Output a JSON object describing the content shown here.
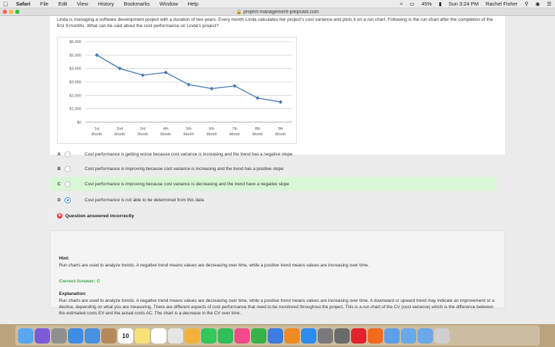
{
  "menubar": {
    "app": "Safari",
    "items": [
      "File",
      "Edit",
      "View",
      "History",
      "Bookmarks",
      "Window",
      "Help"
    ],
    "battery": "45%",
    "clock": "Sun 3:24 PM",
    "user": "Rachel Fisher"
  },
  "browser": {
    "url": "project-management-prepcast.com"
  },
  "question": {
    "text": "Linda is managing a software development project with a duration of two years. Every month Linda calculates her project's cost variance and plots it on a run chart. Following is the run chart after the completion of the first 9 months. What can be said about the cost performance on Linda's project?"
  },
  "chart_data": {
    "type": "line",
    "categories": [
      "1st Month",
      "2nd Month",
      "3rd Month",
      "4th Month",
      "5th Month",
      "6th Month",
      "7th Month",
      "8th Month",
      "9th Month"
    ],
    "category_lines": [
      [
        "1st",
        "Month"
      ],
      [
        "2nd",
        "Month"
      ],
      [
        "3rd",
        "Month"
      ],
      [
        "4th",
        "Month"
      ],
      [
        "5th",
        "Month"
      ],
      [
        "6th",
        "Month"
      ],
      [
        "7th",
        "Month"
      ],
      [
        "8th",
        "Month"
      ],
      [
        "9th",
        "Month"
      ]
    ],
    "values": [
      5000,
      4000,
      3500,
      3700,
      2800,
      2500,
      2700,
      1800,
      1500
    ],
    "yticks": [
      "$0",
      "$1,000",
      "$2,000",
      "$3,000",
      "$4,000",
      "$5,000",
      "$6,000"
    ],
    "ylim": [
      0,
      6000
    ],
    "grid": true,
    "line_color": "#4a7db8",
    "title": "",
    "xlabel": "",
    "ylabel": ""
  },
  "answers": [
    {
      "letter": "A",
      "text": "Cost performance is getting worse because cost variance is increasing and the trend has a negative slope.",
      "selected": false,
      "correct": false
    },
    {
      "letter": "B",
      "text": "Cost performance is improving because cost variance is increasing and the trend has a positive slope",
      "selected": false,
      "correct": false
    },
    {
      "letter": "C",
      "text": "Cost performance is improving because cost variance is decreasing and the trend have a negative slope",
      "selected": false,
      "correct": true
    },
    {
      "letter": "D",
      "text": "Cost performance is not able to be determined from this data",
      "selected": true,
      "correct": false
    }
  ],
  "status": {
    "text": "Question answered incorrectly",
    "color": "#e04444"
  },
  "hint": {
    "label": "Hint:",
    "text": "Run charts are used to analyze trends. A negative trend means values are decreasing over time, while a positive trend means values are increasing over time.",
    "correct_answer": "Correct Answer: C",
    "explanation_label": "Explanation:",
    "explanation": "Run charts are used to analyze trends. A negative trend means values are decreasing over time, while a positive trend means values are increasing over time. A downward or upward trend may indicate an improvement or a decline, depending on what you are measuring. There are different aspects of cost performance that need to be monitored throughout the project. This is a run chart of the CV (cost variance) which is the difference between the estimated costs EV and the actual costs AC. The chart is a decrease in the CV over time."
  },
  "dock": {
    "calendar_day": "10",
    "icons": [
      "finder-icon",
      "siri-icon",
      "launchpad-icon",
      "safari-icon",
      "mail-icon",
      "contacts-icon",
      "calendar-icon",
      "notes-icon",
      "reminders-icon",
      "photos-icon",
      "photos-app-icon",
      "messages-icon",
      "facetime-icon",
      "itunes-icon",
      "numbers-icon",
      "keynote-icon",
      "ibooks-icon",
      "app-store-icon",
      "system-preferences-icon",
      "activity-icon",
      "opera-icon",
      "firefox-icon",
      "preview-icon",
      "folder-icon",
      "downloads-icon",
      "trash-icon"
    ]
  }
}
